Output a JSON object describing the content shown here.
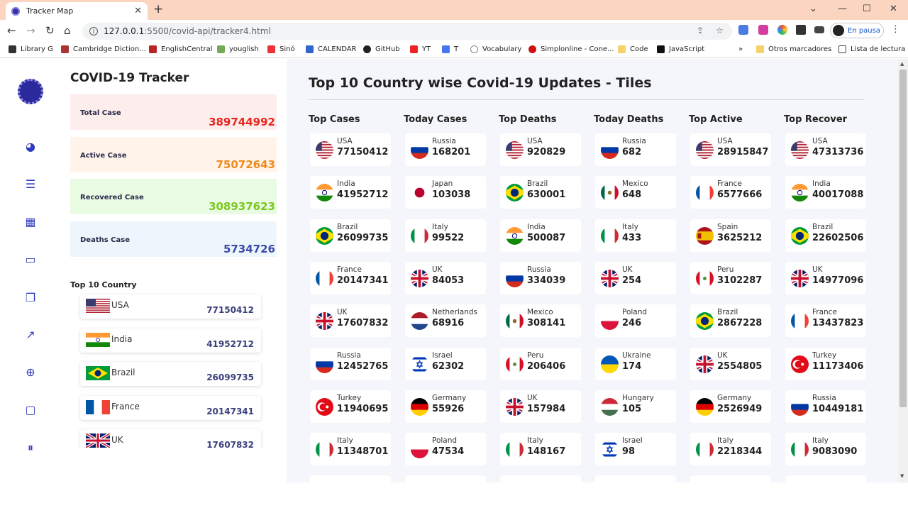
{
  "browser": {
    "tab_title": "Tracker Map",
    "url_host": "127.0.0.1",
    "url_path": ":5500/covid-api/tracker4.html",
    "profile_label": "En pausa",
    "bookmarks": [
      "Library G",
      "Cambridge Diction...",
      "EnglishCentral",
      "youglish",
      "Sinó",
      "CALENDAR",
      "GitHub",
      "YT",
      "T",
      "Vocabulary",
      "Simplonline - Cone...",
      "Code",
      "JavaScript",
      "»",
      "Otros marcadores",
      "Lista de lectura"
    ]
  },
  "sidebar": {
    "icons": [
      "virus-logo-icon",
      "pie-chart-icon",
      "list-icon",
      "grid-icon",
      "folder-icon",
      "copy-icon",
      "trend-chart-icon",
      "globe-icon",
      "chat-icon",
      "pause-icon"
    ]
  },
  "summary": {
    "title": "COVID-19 Tracker",
    "cards": [
      {
        "label": "Total Case",
        "value": "389744992",
        "bg": "#fdeeed",
        "color": "#e8261c"
      },
      {
        "label": "Active Case",
        "value": "75072643",
        "bg": "#fff3ea",
        "color": "#f08a1c"
      },
      {
        "label": "Recovered Case",
        "value": "308937623",
        "bg": "#eafbe4",
        "color": "#78c81c"
      },
      {
        "label": "Deaths Case",
        "value": "5734726",
        "bg": "#eef6fd",
        "color": "#3b4ba7"
      }
    ],
    "top10_title": "Top 10 Country",
    "top10": [
      {
        "country": "USA",
        "value": "77150412",
        "flag": "usa"
      },
      {
        "country": "India",
        "value": "41952712",
        "flag": "india"
      },
      {
        "country": "Brazil",
        "value": "26099735",
        "flag": "brazil"
      },
      {
        "country": "France",
        "value": "20147341",
        "flag": "france"
      },
      {
        "country": "UK",
        "value": "17607832",
        "flag": "uk"
      }
    ]
  },
  "main": {
    "title": "Top 10 Country wise Covid-19 Updates - Tiles",
    "columns": [
      {
        "title": "Top Cases",
        "tiles": [
          {
            "c": "USA",
            "v": "77150412",
            "f": "usa"
          },
          {
            "c": "India",
            "v": "41952712",
            "f": "india"
          },
          {
            "c": "Brazil",
            "v": "26099735",
            "f": "brazil"
          },
          {
            "c": "France",
            "v": "20147341",
            "f": "france"
          },
          {
            "c": "UK",
            "v": "17607832",
            "f": "uk"
          },
          {
            "c": "Russia",
            "v": "12452765",
            "f": "russia"
          },
          {
            "c": "Turkey",
            "v": "11940695",
            "f": "turkey"
          },
          {
            "c": "Italy",
            "v": "11348701",
            "f": "italy"
          }
        ]
      },
      {
        "title": "Today Cases",
        "tiles": [
          {
            "c": "Russia",
            "v": "168201",
            "f": "russia"
          },
          {
            "c": "Japan",
            "v": "103038",
            "f": "japan"
          },
          {
            "c": "Italy",
            "v": "99522",
            "f": "italy"
          },
          {
            "c": "UK",
            "v": "84053",
            "f": "uk"
          },
          {
            "c": "Netherlands",
            "v": "68916",
            "f": "netherlands"
          },
          {
            "c": "Israel",
            "v": "62302",
            "f": "israel"
          },
          {
            "c": "Germany",
            "v": "55926",
            "f": "germany"
          },
          {
            "c": "Poland",
            "v": "47534",
            "f": "poland"
          }
        ]
      },
      {
        "title": "Top Deaths",
        "tiles": [
          {
            "c": "USA",
            "v": "920829",
            "f": "usa"
          },
          {
            "c": "Brazil",
            "v": "630001",
            "f": "brazil"
          },
          {
            "c": "India",
            "v": "500087",
            "f": "india"
          },
          {
            "c": "Russia",
            "v": "334039",
            "f": "russia"
          },
          {
            "c": "Mexico",
            "v": "308141",
            "f": "mexico"
          },
          {
            "c": "Peru",
            "v": "206406",
            "f": "peru"
          },
          {
            "c": "UK",
            "v": "157984",
            "f": "uk"
          },
          {
            "c": "Italy",
            "v": "148167",
            "f": "italy"
          }
        ]
      },
      {
        "title": "Today Deaths",
        "tiles": [
          {
            "c": "Russia",
            "v": "682",
            "f": "russia"
          },
          {
            "c": "Mexico",
            "v": "648",
            "f": "mexico"
          },
          {
            "c": "Italy",
            "v": "433",
            "f": "italy"
          },
          {
            "c": "UK",
            "v": "254",
            "f": "uk"
          },
          {
            "c": "Poland",
            "v": "246",
            "f": "poland"
          },
          {
            "c": "Ukraine",
            "v": "174",
            "f": "ukraine"
          },
          {
            "c": "Hungary",
            "v": "105",
            "f": "hungary"
          },
          {
            "c": "Israel",
            "v": "98",
            "f": "israel"
          }
        ]
      },
      {
        "title": "Top Active",
        "tiles": [
          {
            "c": "USA",
            "v": "28915847",
            "f": "usa"
          },
          {
            "c": "France",
            "v": "6577666",
            "f": "france"
          },
          {
            "c": "Spain",
            "v": "3625212",
            "f": "spain"
          },
          {
            "c": "Peru",
            "v": "3102287",
            "f": "peru"
          },
          {
            "c": "Brazil",
            "v": "2867228",
            "f": "brazil"
          },
          {
            "c": "UK",
            "v": "2554805",
            "f": "uk"
          },
          {
            "c": "Germany",
            "v": "2526949",
            "f": "germany"
          },
          {
            "c": "Italy",
            "v": "2218344",
            "f": "italy"
          }
        ]
      },
      {
        "title": "Top Recover",
        "tiles": [
          {
            "c": "USA",
            "v": "47313736",
            "f": "usa"
          },
          {
            "c": "India",
            "v": "40017088",
            "f": "india"
          },
          {
            "c": "Brazil",
            "v": "22602506",
            "f": "brazil"
          },
          {
            "c": "UK",
            "v": "14977096",
            "f": "uk"
          },
          {
            "c": "France",
            "v": "13437823",
            "f": "france"
          },
          {
            "c": "Turkey",
            "v": "11173406",
            "f": "turkey"
          },
          {
            "c": "Russia",
            "v": "10449181",
            "f": "russia"
          },
          {
            "c": "Italy",
            "v": "9083090",
            "f": "italy"
          }
        ]
      }
    ]
  }
}
